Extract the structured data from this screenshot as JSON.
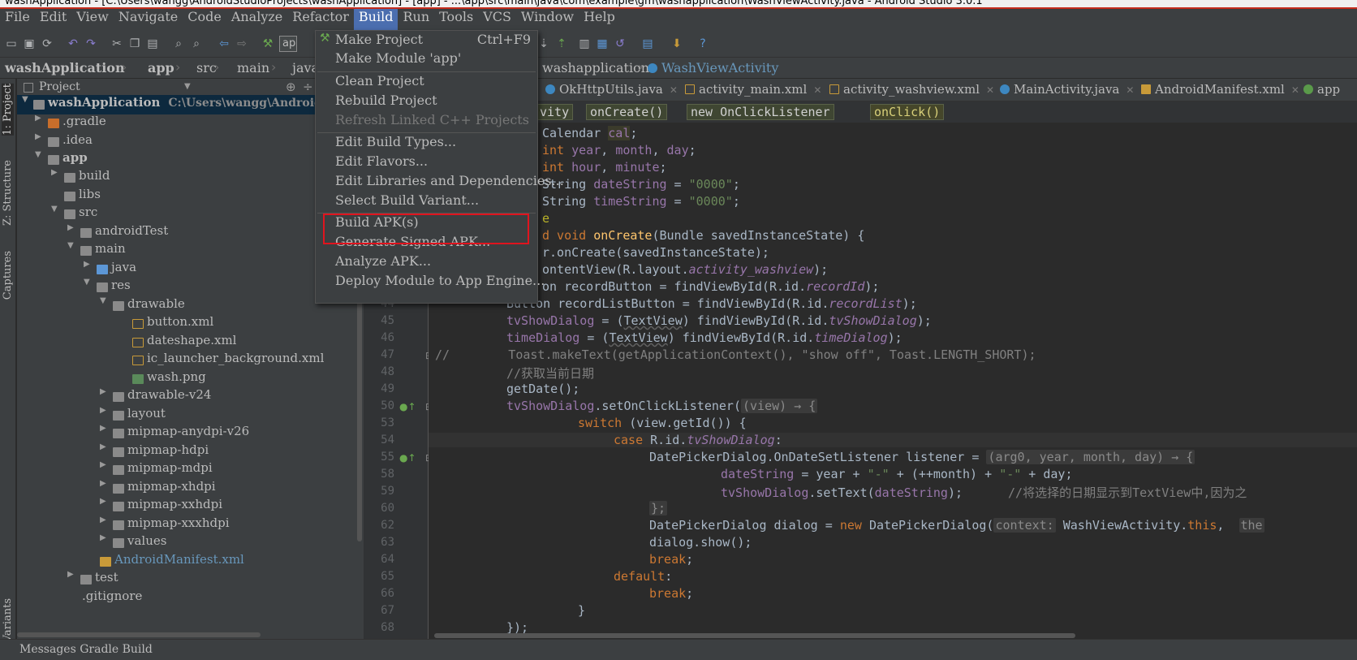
{
  "window": {
    "title": "washApplication - [C:\\Users\\wangg\\AndroidStudioProjects\\washApplication] - [app] - ...\\app\\src\\main\\java\\com\\example\\gm\\washapplication\\WashViewActivity.java - Android Studio 3.0.1"
  },
  "menu": [
    "File",
    "Edit",
    "View",
    "Navigate",
    "Code",
    "Analyze",
    "Refactor",
    "Build",
    "Run",
    "Tools",
    "VCS",
    "Window",
    "Help"
  ],
  "toolbar": {
    "run_config": "ap"
  },
  "nav": {
    "crumbs": [
      "washApplication",
      "app",
      "src",
      "main",
      "java"
    ],
    "tail": [
      "washapplication",
      "WashViewActivity"
    ]
  },
  "left_stripe": [
    "1: Project",
    "Z: Structure",
    "Captures",
    "Build Variants"
  ],
  "project": {
    "header": "Project",
    "tree": [
      {
        "label": "washApplication",
        "path": "C:\\Users\\wangg\\AndroidStu"
      },
      {
        "label": ".gradle"
      },
      {
        "label": ".idea"
      },
      {
        "label": "app"
      },
      {
        "label": "build"
      },
      {
        "label": "libs"
      },
      {
        "label": "src"
      },
      {
        "label": "androidTest"
      },
      {
        "label": "main"
      },
      {
        "label": "java"
      },
      {
        "label": "res"
      },
      {
        "label": "drawable"
      },
      {
        "label": "button.xml"
      },
      {
        "label": "dateshape.xml"
      },
      {
        "label": "ic_launcher_background.xml"
      },
      {
        "label": "wash.png"
      },
      {
        "label": "drawable-v24"
      },
      {
        "label": "layout"
      },
      {
        "label": "mipmap-anydpi-v26"
      },
      {
        "label": "mipmap-hdpi"
      },
      {
        "label": "mipmap-mdpi"
      },
      {
        "label": "mipmap-xhdpi"
      },
      {
        "label": "mipmap-xxhdpi"
      },
      {
        "label": "mipmap-xxxhdpi"
      },
      {
        "label": "values"
      },
      {
        "label": "AndroidManifest.xml"
      },
      {
        "label": "test"
      },
      {
        "label": ".gitignore"
      }
    ]
  },
  "editor_tabs": [
    "OkHttpUtils.java",
    "activity_main.xml",
    "activity_washview.xml",
    "MainActivity.java",
    "AndroidManifest.xml",
    "app"
  ],
  "code_crumbs": [
    "vity",
    "onCreate()",
    "new OnClickListener",
    "onClick()"
  ],
  "line_numbers": [
    "44",
    "45",
    "46",
    "47",
    "48",
    "49",
    "50",
    "53",
    "54",
    "55",
    "58",
    "59",
    "60",
    "62",
    "63",
    "64",
    "65",
    "66",
    "67",
    "68"
  ],
  "code": {
    "l1": "Calendar ",
    "l1b": "cal",
    "l1c": ";",
    "l2a": "int ",
    "l2b": "year",
    "l2c": ", ",
    "l2d": "month",
    "l2e": ", ",
    "l2f": "day",
    "l2g": ";",
    "l3a": "int ",
    "l3b": "hour",
    "l3c": ", ",
    "l3d": "minute",
    "l3e": ";",
    "l4a": "String ",
    "l4b": "dateString",
    "l4c": " = ",
    "l4d": "\"0000\"",
    "l4e": ";",
    "l5a": "String ",
    "l5b": "timeString",
    "l5c": " = ",
    "l5d": "\"0000\"",
    "l5e": ";",
    "l6": "e",
    "l7a": "d void ",
    "l7b": "onCreate",
    "l7c": "(Bundle savedInstanceState) {",
    "l8": "r.onCreate(savedInstanceState);",
    "l9a": "ontentView(R.layout.",
    "l9b": "activity_washview",
    "l9c": ");",
    "l10a": "on recordButton = findViewById(R.id.",
    "l10b": "recordId",
    "l10c": ");",
    "l11a": "Button recordListButton = findViewById(R.id.",
    "l11b": "recordList",
    "l11c": ");",
    "l12a": "tvShowDialog",
    "l12b": " = (",
    "l12c": "TextView",
    "l12d": ") findViewById(R.id.",
    "l12e": "tvShowDialog",
    "l12f": ");",
    "l13a": "timeDialog",
    "l13b": " = (",
    "l13c": "TextView",
    "l13d": ") findViewById(R.id.",
    "l13e": "timeDialog",
    "l13f": ");",
    "l14": "//        Toast.makeText(getApplicationContext(), \"show off\", Toast.LENGTH_SHORT);",
    "l15": "//获取当前日期",
    "l16": "getDate();",
    "l17a": "tvShowDialog",
    "l17b": ".setOnClickListener(",
    "l17c": "(view) → {",
    "l18a": "switch ",
    "l18b": "(view.getId()) {",
    "l19a": "case ",
    "l19b": "R.id.",
    "l19c": "tvShowDialog",
    "l19d": ":",
    "l20a": "DatePickerDialog.OnDateSetListener listener = ",
    "l20b": "(arg0, year, month, day) → {",
    "l21a": "dateString",
    "l21b": " = year + ",
    "l21c": "\"-\"",
    "l21d": " + (++month) + ",
    "l21e": "\"-\"",
    "l21f": " + day;",
    "l22a": "tvShowDialog",
    "l22b": ".setText(",
    "l22c": "dateString",
    "l22d": ");",
    "l22e": "//将选择的日期显示到TextView中,因为之",
    "l23": "};",
    "l24a": "DatePickerDialog dialog = ",
    "l24b": "new ",
    "l24c": "DatePickerDialog(",
    "l24d": "context:",
    "l24e": " WashViewActivity.",
    "l24f": "this",
    "l24g": ",  ",
    "l24h": "the",
    "l25": "dialog.show();",
    "l26a": "break",
    "l26b": ";",
    "l27a": "default",
    "l27b": ":",
    "l28a": "break",
    "l28b": ";",
    "l29": "}",
    "l30": "});"
  },
  "build_menu": {
    "items": [
      {
        "label": "Make Project",
        "shortcut": "Ctrl+F9"
      },
      {
        "label": "Make Module 'app'"
      },
      {
        "label": "Clean Project"
      },
      {
        "label": "Rebuild Project"
      },
      {
        "label": "Refresh Linked C++ Projects"
      },
      {
        "label": "Edit Build Types..."
      },
      {
        "label": "Edit Flavors..."
      },
      {
        "label": "Edit Libraries and Dependencies..."
      },
      {
        "label": "Select Build Variant..."
      },
      {
        "label": "Build APK(s)"
      },
      {
        "label": "Generate Signed APK..."
      },
      {
        "label": "Analyze APK..."
      },
      {
        "label": "Deploy Module to App Engine..."
      }
    ]
  },
  "status_bar": {
    "text": "Messages Gradle Build"
  },
  "colors": {
    "highlight": "#e0141e",
    "menu_active": "#4b6eaf",
    "background": "#2b2b2b"
  }
}
